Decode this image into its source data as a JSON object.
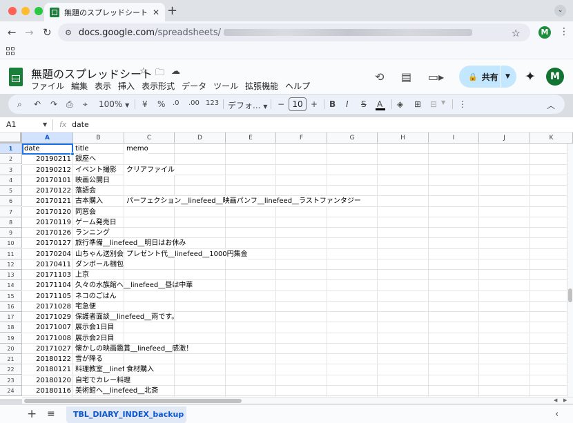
{
  "browser": {
    "tab_title": "無題のスプレッドシート - Google",
    "url_host": "docs.google.com",
    "url_path": "/spreadsheets/",
    "profile_initial": "M"
  },
  "doc": {
    "title": "無題のスプレッドシート",
    "menus": [
      "ファイル",
      "編集",
      "表示",
      "挿入",
      "表示形式",
      "データ",
      "ツール",
      "拡張機能",
      "ヘルプ"
    ],
    "share_label": "共有",
    "account_initial": "M"
  },
  "toolbar": {
    "zoom": "100%",
    "currency": "¥",
    "percent": "%",
    "dec_decrease": ".0",
    "dec_increase": ".00",
    "format_123": "123",
    "font": "デフォ...",
    "font_size": "10"
  },
  "formula_bar": {
    "cell_ref": "A1",
    "fx": "fx",
    "content": "date"
  },
  "grid": {
    "columns": [
      "A",
      "B",
      "C",
      "D",
      "E",
      "F",
      "G",
      "H",
      "I",
      "J",
      "K"
    ],
    "rows": [
      {
        "n": "1",
        "a": "date",
        "b": "title",
        "c": "memo"
      },
      {
        "n": "2",
        "a": "20190211",
        "b": "銀座へ",
        "c": ""
      },
      {
        "n": "3",
        "a": "20190212",
        "b": "イベント撮影",
        "c": "クリアファイル"
      },
      {
        "n": "4",
        "a": "20170101",
        "b": "映画公開日",
        "c": ""
      },
      {
        "n": "5",
        "a": "20170122",
        "b": "落語会",
        "c": ""
      },
      {
        "n": "6",
        "a": "20170121",
        "b": "古本購入",
        "c": "パーフェクション__linefeed__映画パンフ__linefeed__ラストファンタジー"
      },
      {
        "n": "7",
        "a": "20170120",
        "b": "同窓会",
        "c": ""
      },
      {
        "n": "8",
        "a": "20170119",
        "b": "ゲーム発売日",
        "c": ""
      },
      {
        "n": "9",
        "a": "20170126",
        "b": "ランニング",
        "c": ""
      },
      {
        "n": "10",
        "a": "20170127",
        "b": "旅行準備__linefeed__明日はお休み",
        "c": ""
      },
      {
        "n": "11",
        "a": "20170204",
        "b": "山ちゃん送別会",
        "c": "プレゼント代__linefeed__1000円集金"
      },
      {
        "n": "12",
        "a": "20170411",
        "b": "ダンボール梱包",
        "c": ""
      },
      {
        "n": "13",
        "a": "20171103",
        "b": "上京",
        "c": ""
      },
      {
        "n": "14",
        "a": "20171104",
        "b": "久々の水族館へ__linefeed__昼は中華",
        "c": ""
      },
      {
        "n": "15",
        "a": "20171105",
        "b": "ネコのごはん",
        "c": ""
      },
      {
        "n": "16",
        "a": "20171028",
        "b": "宅急便",
        "c": ""
      },
      {
        "n": "17",
        "a": "20171029",
        "b": "保護者面談__linefeed__雨です。",
        "c": ""
      },
      {
        "n": "18",
        "a": "20171007",
        "b": "展示会1日目",
        "c": ""
      },
      {
        "n": "19",
        "a": "20171008",
        "b": "展示会2日目",
        "c": ""
      },
      {
        "n": "20",
        "a": "20171027",
        "b": "懐かしの映画鑑賞__linefeed__感激！",
        "c": ""
      },
      {
        "n": "21",
        "a": "20180122",
        "b": "雪が降る",
        "c": ""
      },
      {
        "n": "22",
        "a": "20180121",
        "b": "料理教室__linefeed__",
        "c": "食材購入"
      },
      {
        "n": "23",
        "a": "20180120",
        "b": "自宅でカレー料理",
        "c": ""
      },
      {
        "n": "24",
        "a": "20180116",
        "b": "美術館へ__linefeed__北斎",
        "c": ""
      }
    ]
  },
  "sheet_tabs": {
    "active": "TBL_DIARY_INDEX_backup"
  }
}
